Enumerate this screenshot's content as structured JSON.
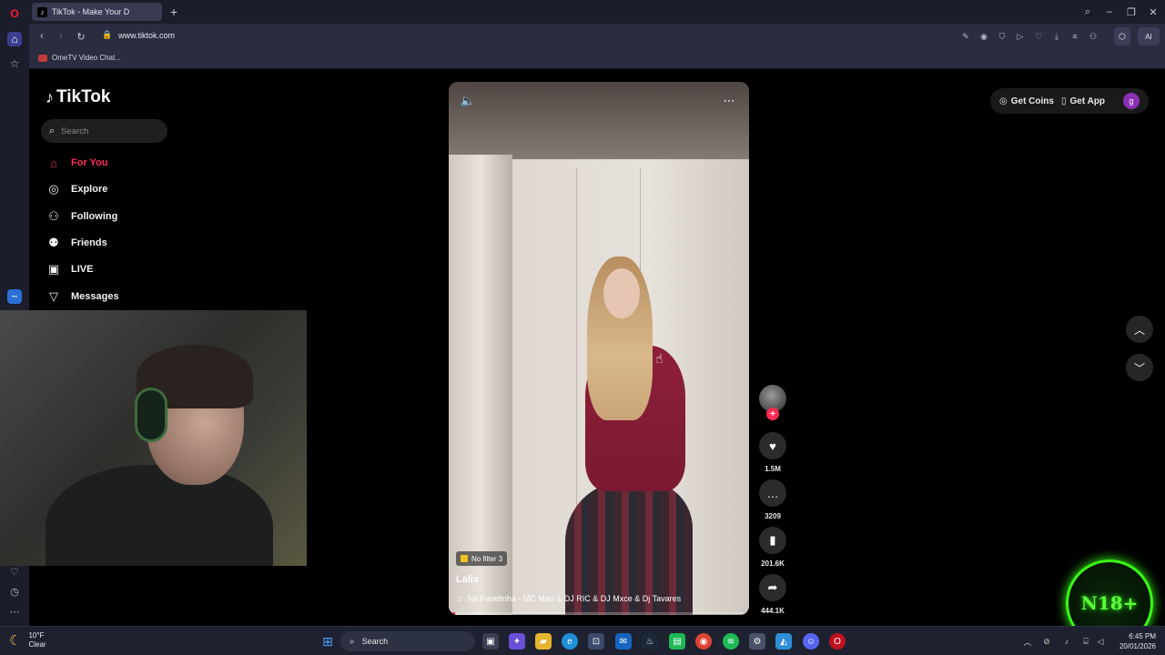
{
  "browser": {
    "tab_title": "TikTok - Make Your D",
    "url": "www.tiktok.com",
    "bookmark": "OmeTV Video Chat..."
  },
  "sidebar": {
    "logo": "TikTok",
    "search_placeholder": "Search",
    "items": [
      {
        "label": "For You",
        "icon": "home-icon"
      },
      {
        "label": "Explore",
        "icon": "compass-icon"
      },
      {
        "label": "Following",
        "icon": "following-icon"
      },
      {
        "label": "Friends",
        "icon": "friends-icon"
      },
      {
        "label": "LIVE",
        "icon": "live-icon"
      },
      {
        "label": "Messages",
        "icon": "messages-icon"
      }
    ]
  },
  "header": {
    "get_coins": "Get Coins",
    "get_app": "Get App",
    "user_initial": "g"
  },
  "video": {
    "badge": "No filter 3",
    "author": "Lalix",
    "music": "Na Favelinha - MC Mari & DJ RIC & DJ Mxce & Dj Tavares",
    "progress": 0.02
  },
  "actions": {
    "likes": "1.5M",
    "comments": "3209",
    "saves": "201.6K",
    "shares": "444.1K"
  },
  "overlay": {
    "badge_text": "N18+"
  },
  "taskbar": {
    "temperature": "10°F",
    "condition": "Clear",
    "search": "Search",
    "time": "6:45 PM",
    "date": "20/01/2026"
  },
  "colors": {
    "accent": "#fe2c55",
    "browser_bg": "#1c1d2b",
    "neon": "#39ff14"
  }
}
